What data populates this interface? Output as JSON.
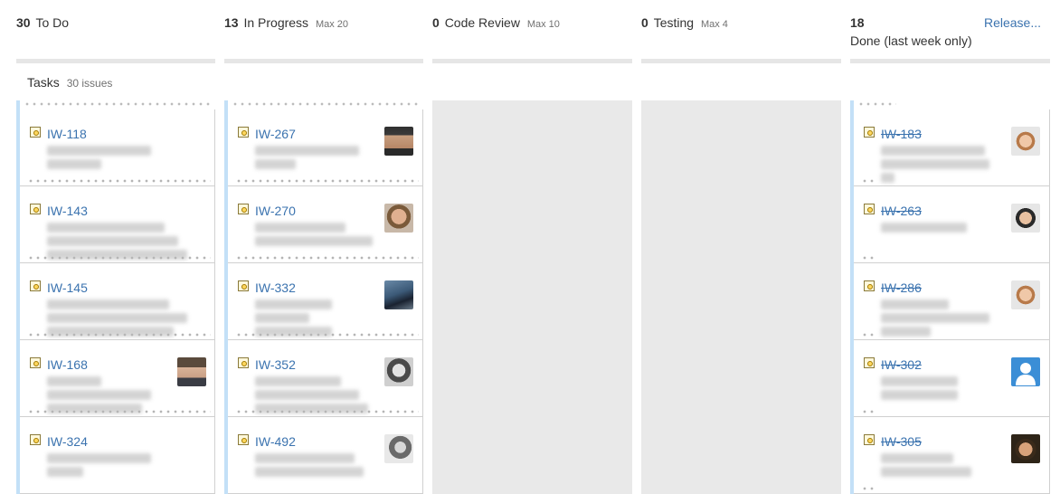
{
  "columns": [
    {
      "count": "30",
      "name": "To Do",
      "max": ""
    },
    {
      "count": "13",
      "name": "In Progress",
      "max": "Max 20"
    },
    {
      "count": "0",
      "name": "Code Review",
      "max": "Max 10"
    },
    {
      "count": "0",
      "name": "Testing",
      "max": "Max 4"
    },
    {
      "count": "18",
      "name": "Done (last week only)",
      "max": "",
      "release_label": "Release..."
    }
  ],
  "swimlane": {
    "name": "Tasks",
    "count": "30 issues"
  },
  "cards": {
    "todo": [
      {
        "key": "IW-118"
      },
      {
        "key": "IW-143"
      },
      {
        "key": "IW-145"
      },
      {
        "key": "IW-168"
      },
      {
        "key": "IW-324"
      }
    ],
    "inprogress": [
      {
        "key": "IW-267"
      },
      {
        "key": "IW-270"
      },
      {
        "key": "IW-332"
      },
      {
        "key": "IW-352"
      },
      {
        "key": "IW-492"
      }
    ],
    "done": [
      {
        "key": "IW-183"
      },
      {
        "key": "IW-263"
      },
      {
        "key": "IW-286"
      },
      {
        "key": "IW-302"
      },
      {
        "key": "IW-305"
      }
    ]
  },
  "colors": {
    "link": "#3b73af",
    "accent": "#c3e0f7",
    "empty_column": "#e9e9e9",
    "header_bar": "#e6e6e6"
  },
  "icons": {
    "issue_type": "task-icon",
    "avatar": "user-avatar"
  }
}
